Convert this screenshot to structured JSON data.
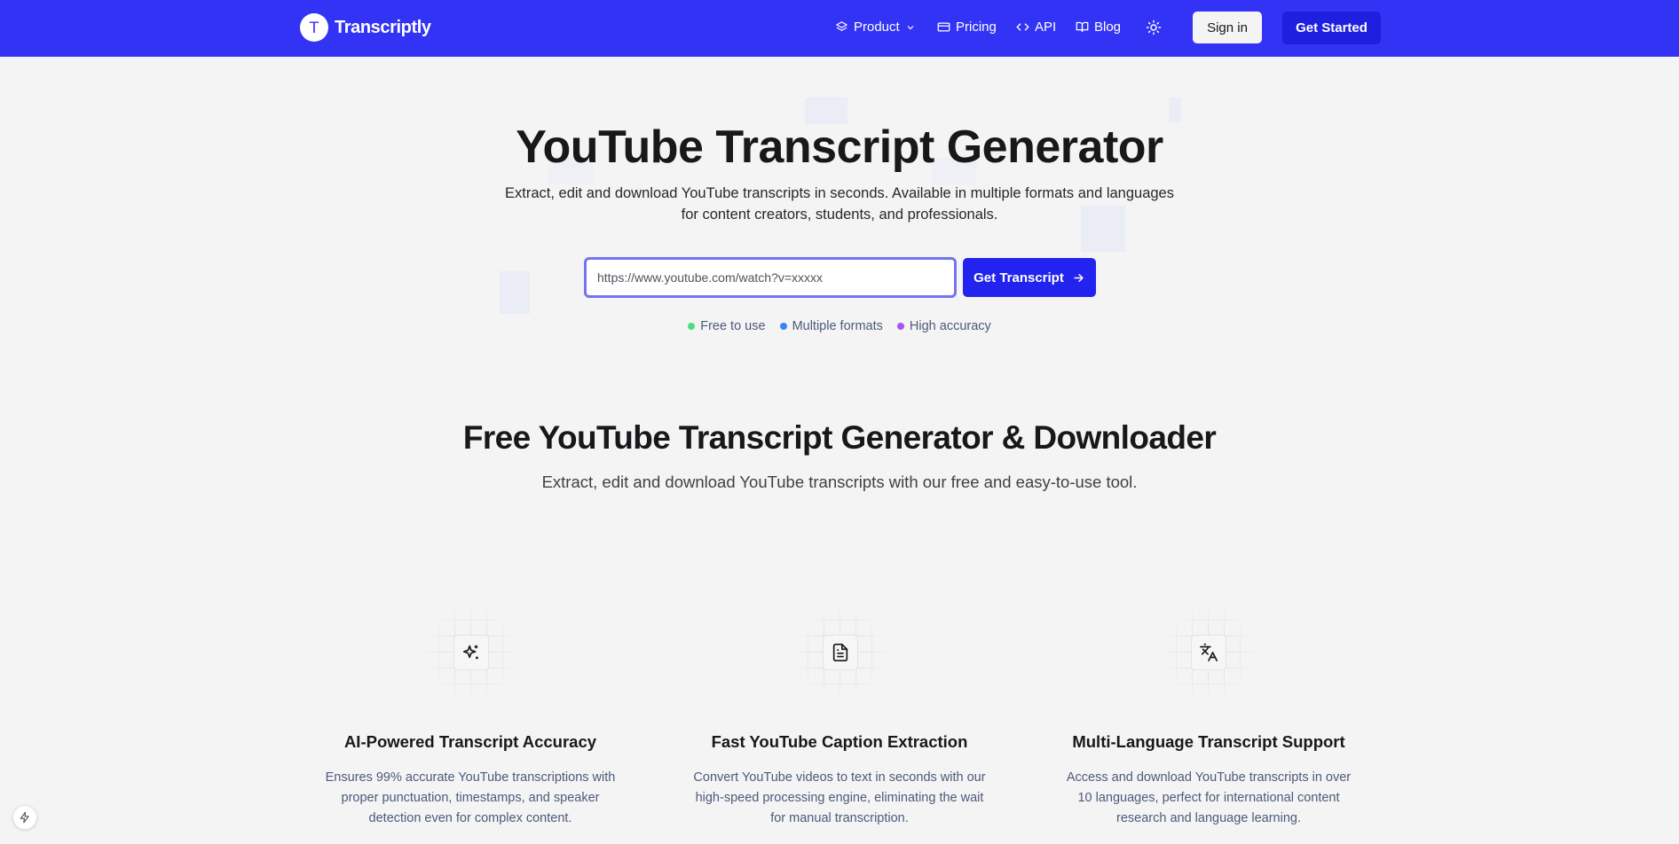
{
  "brand": {
    "logo_letter": "T",
    "name": "Transcriptly"
  },
  "nav": {
    "product": "Product",
    "pricing": "Pricing",
    "api": "API",
    "blog": "Blog",
    "sign_in": "Sign in",
    "get_started": "Get Started"
  },
  "hero": {
    "title": "YouTube Transcript Generator",
    "subtitle": "Extract, edit and download YouTube transcripts in seconds. Available in multiple formats and languages for content creators, students, and professionals.",
    "input_placeholder": "https://www.youtube.com/watch?v=xxxxx",
    "cta": "Get Transcript",
    "badges": [
      {
        "label": "Free to use",
        "color": "#4ade80"
      },
      {
        "label": "Multiple formats",
        "color": "#3b82f6"
      },
      {
        "label": "High accuracy",
        "color": "#a855f7"
      }
    ]
  },
  "section": {
    "title": "Free YouTube Transcript Generator & Downloader",
    "subtitle": "Extract, edit and download YouTube transcripts with our free and easy-to-use tool."
  },
  "cards": [
    {
      "icon": "sparkles-icon",
      "title": "AI-Powered Transcript Accuracy",
      "desc": "Ensures 99% accurate YouTube transcriptions with proper punctuation, timestamps, and speaker detection even for complex content."
    },
    {
      "icon": "document-icon",
      "title": "Fast YouTube Caption Extraction",
      "desc": "Convert YouTube videos to text in seconds with our high-speed processing engine, eliminating the wait for manual transcription."
    },
    {
      "icon": "translate-icon",
      "title": "Multi-Language Transcript Support",
      "desc": "Access and download YouTube transcripts in over 10 languages, perfect for international content research and language learning."
    }
  ],
  "colors": {
    "nav_bg": "#3333f5",
    "primary_button": "#2323f0",
    "page_bg": "#f4f4f4"
  }
}
